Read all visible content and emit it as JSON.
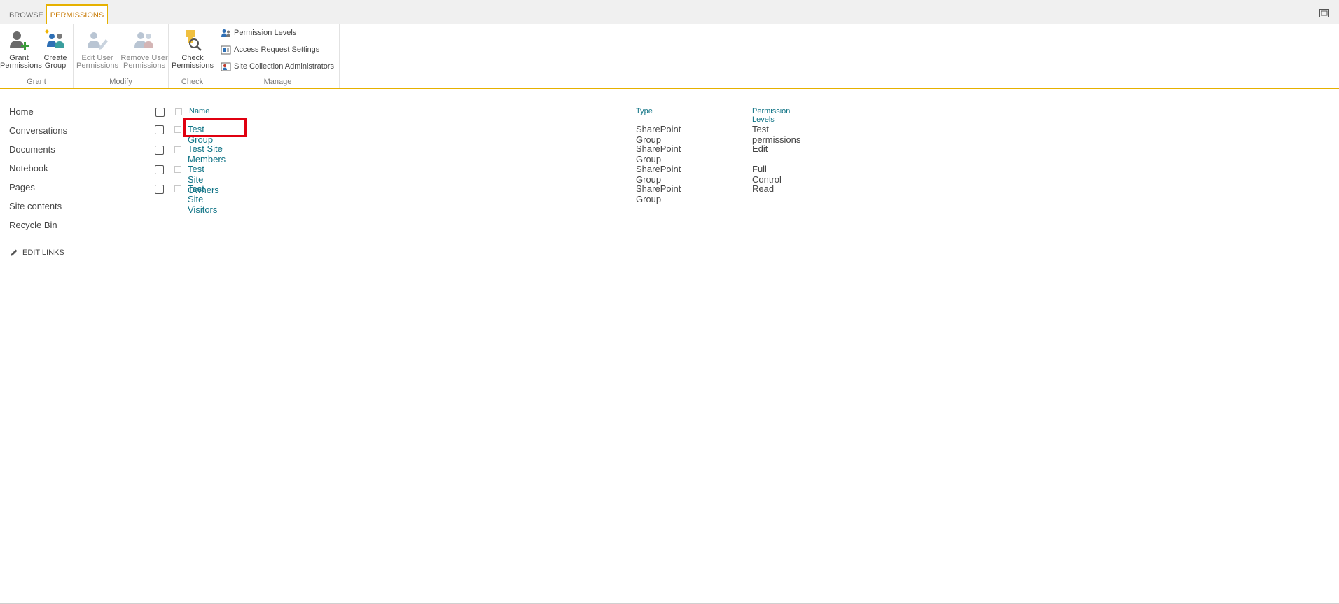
{
  "tabs": {
    "browse": "BROWSE",
    "permissions": "PERMISSIONS"
  },
  "ribbon": {
    "grant": {
      "label": "Grant",
      "grant_permissions": [
        "Grant",
        "Permissions"
      ],
      "create_group": [
        "Create",
        "Group"
      ]
    },
    "modify": {
      "label": "Modify",
      "edit_user_permissions": [
        "Edit User",
        "Permissions"
      ],
      "remove_user_permissions": [
        "Remove User",
        "Permissions"
      ]
    },
    "check": {
      "label": "Check",
      "check_permissions": [
        "Check",
        "Permissions"
      ]
    },
    "manage": {
      "label": "Manage",
      "permission_levels": "Permission Levels",
      "access_request_settings": "Access Request Settings",
      "site_collection_administrators": "Site Collection Administrators"
    }
  },
  "leftnav": {
    "items": [
      "Home",
      "Conversations",
      "Documents",
      "Notebook",
      "Pages",
      "Site contents",
      "Recycle Bin"
    ],
    "edit_links": "EDIT LINKS"
  },
  "table": {
    "headers": {
      "name": "Name",
      "type": "Type",
      "permission_levels": "Permission Levels"
    },
    "rows": [
      {
        "name": "Test Group",
        "type": "SharePoint Group",
        "permission_levels": "Test permissions"
      },
      {
        "name": "Test Site Members",
        "type": "SharePoint Group",
        "permission_levels": "Edit"
      },
      {
        "name": "Test Site Owners",
        "type": "SharePoint Group",
        "permission_levels": "Full Control"
      },
      {
        "name": "Test Site Visitors",
        "type": "SharePoint Group",
        "permission_levels": "Read"
      }
    ]
  },
  "colors": {
    "accent": "#e6b100",
    "link": "#0f7385",
    "highlight": "#e00010",
    "tab_active": "#c77800"
  }
}
